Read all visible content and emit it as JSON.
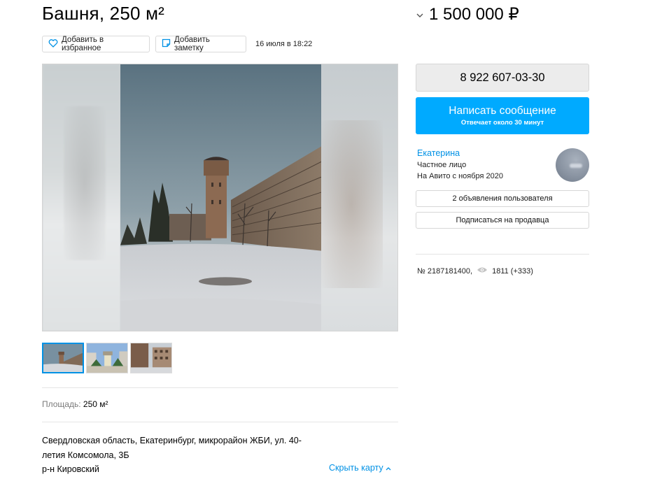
{
  "listing": {
    "title": "Башня, 250 м²",
    "price": "1 500 000 ₽",
    "date": "16 июля в 18:22"
  },
  "actions": {
    "favorite_label": "Добавить в избранное",
    "note_label": "Добавить заметку"
  },
  "gallery": {
    "thumbnails": [
      "thumb-1",
      "thumb-2",
      "thumb-3"
    ],
    "active_index": 0
  },
  "params": {
    "area_label": "Площадь:",
    "area_value": "250 м²"
  },
  "location": {
    "address_line1": "Свердловская область, Екатеринбург, микрорайон ЖБИ, ул. 40-",
    "address_line2": "летия Комсомола, 3Б",
    "district": "р-н Кировский",
    "map_toggle": "Скрыть карту"
  },
  "contact": {
    "phone": "8 922 607-03-30",
    "message_label": "Написать сообщение",
    "message_sub": "Отвечает около 30 минут"
  },
  "seller": {
    "name": "Екатерина",
    "type": "Частное лицо",
    "since": "На Авито с ноября 2020",
    "ads_button": "2 объявления пользователя",
    "subscribe_button": "Подписаться на продавца"
  },
  "meta": {
    "item_number": "№ 2187181400,",
    "views": "1811 (+333)"
  },
  "colors": {
    "accent": "#00aaff",
    "link": "#0091e5"
  }
}
